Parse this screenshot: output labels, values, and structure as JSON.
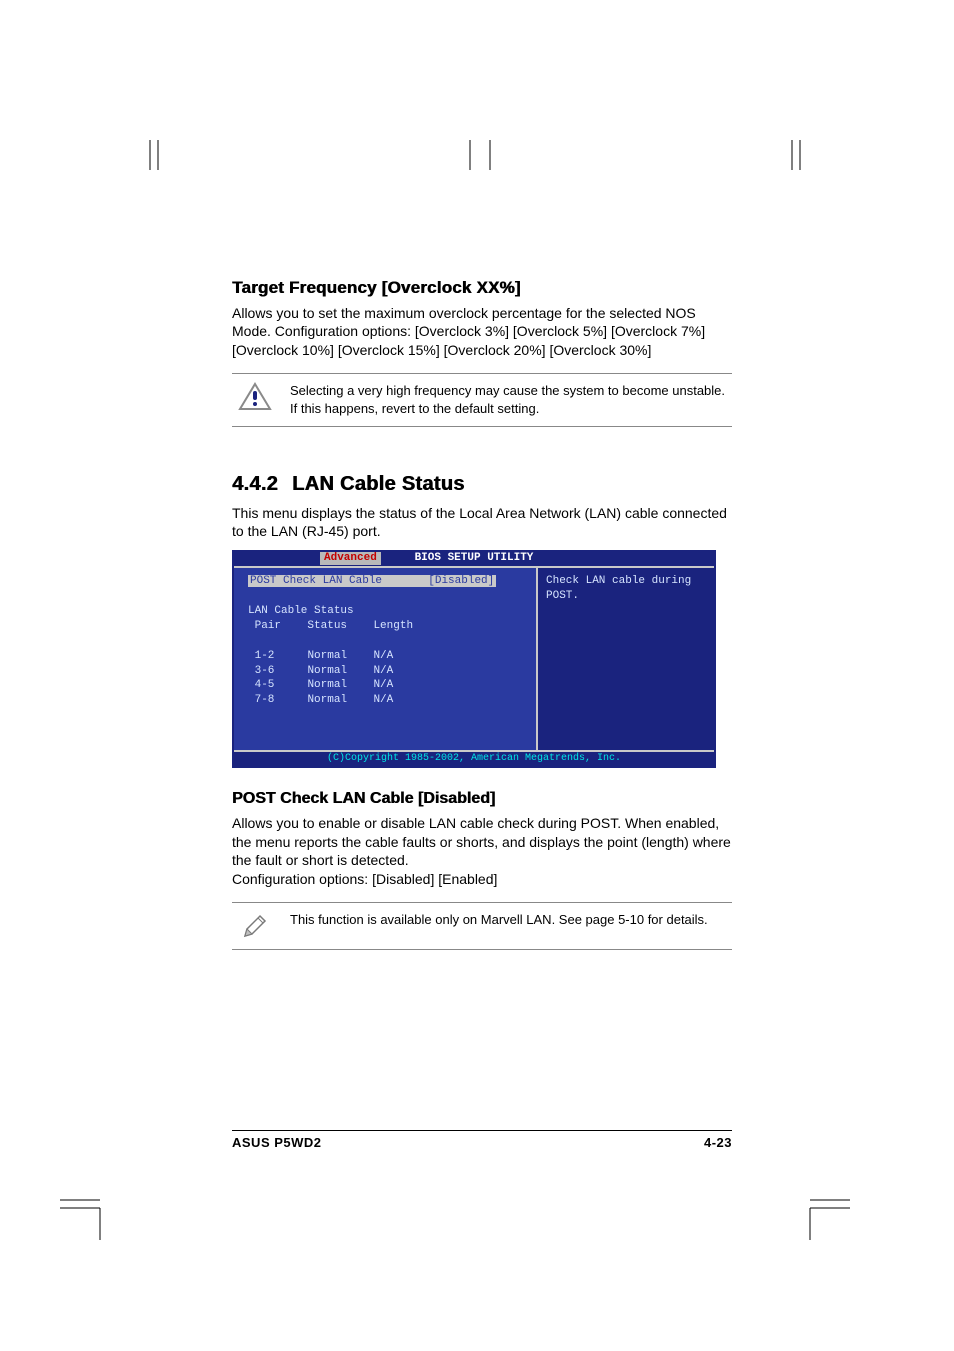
{
  "section1": {
    "title": "Target Frequency [Overclock XX%]",
    "body": "Allows you to set the maximum overclock percentage for the selected NOS Mode. Configuration options: [Overclock 3%] [Overclock 5%] [Overclock 7%] [Overclock 10%] [Overclock 15%] [Overclock 20%] [Overclock 30%]",
    "note": "Selecting a very high frequency may cause the system to become unstable. If this happens, revert to the default setting."
  },
  "section2": {
    "num": "4.4.2",
    "title": "LAN Cable Status",
    "intro": "This menu displays the status of the Local Area Network (LAN) cable connected to the LAN (RJ-45) port."
  },
  "bios": {
    "title": "BIOS SETUP UTILITY",
    "tab": "Advanced",
    "selected_label": "POST Check LAN Cable",
    "selected_value": "[Disabled]",
    "sub_header": "LAN Cable Status",
    "col_pair": "Pair",
    "col_status": "Status",
    "col_length": "Length",
    "rows": [
      {
        "pair": "1-2",
        "status": "Normal",
        "length": "N/A"
      },
      {
        "pair": "3-6",
        "status": "Normal",
        "length": "N/A"
      },
      {
        "pair": "4-5",
        "status": "Normal",
        "length": "N/A"
      },
      {
        "pair": "7-8",
        "status": "Normal",
        "length": "N/A"
      }
    ],
    "help": "Check LAN cable during POST.",
    "copyright": "(C)Copyright 1985-2002, American Megatrends, Inc."
  },
  "section3": {
    "title": "POST Check LAN Cable [Disabled]",
    "body": "Allows you to enable or disable LAN cable check during POST. When enabled, the menu reports the cable faults or shorts, and displays the point (length) where the fault or short is detected.",
    "config": "Configuration options: [Disabled] [Enabled]",
    "note": "This function is available only on Marvell LAN. See page 5-10 for details."
  },
  "footer": {
    "left": "ASUS P5WD2",
    "right": "4-23"
  }
}
